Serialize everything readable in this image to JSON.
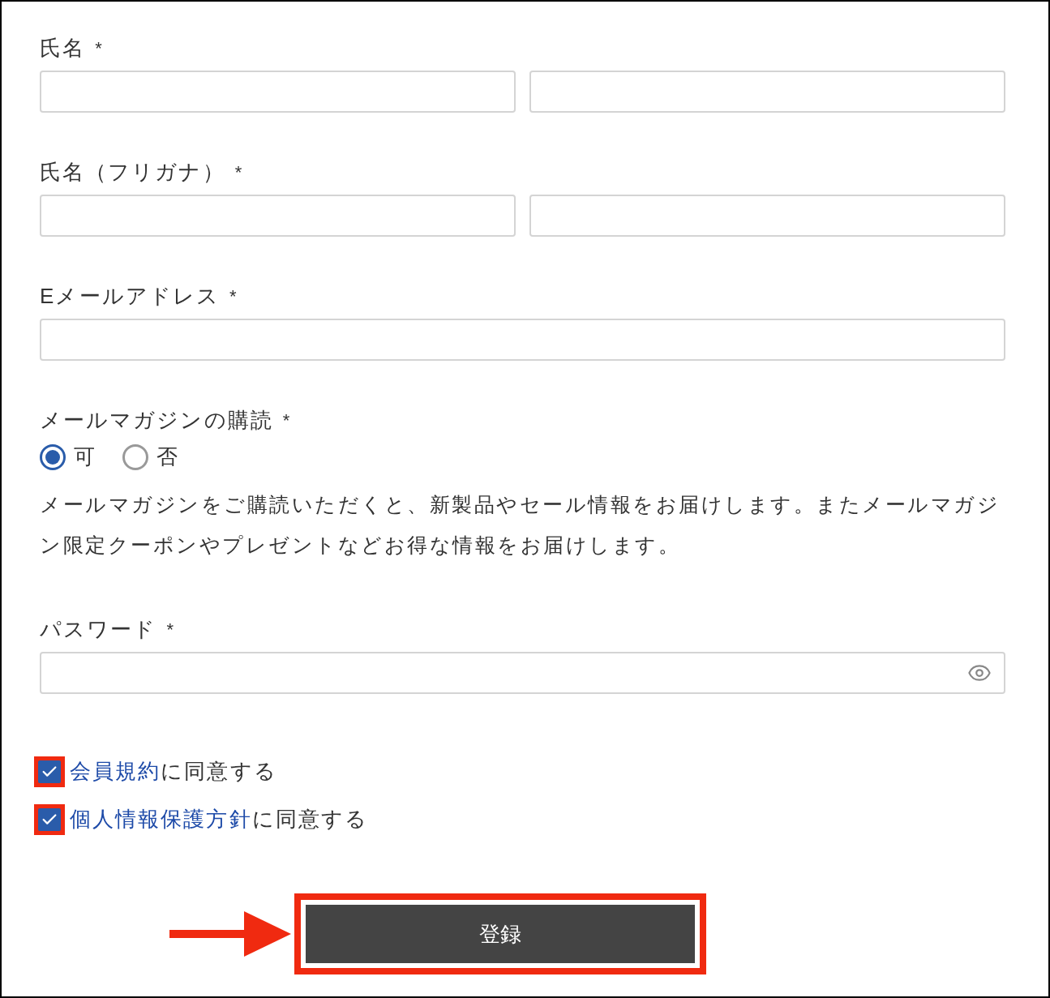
{
  "fields": [
    {
      "label": "氏名",
      "required_mark": "*",
      "kind": "double"
    },
    {
      "label": "氏名（フリガナ）",
      "required_mark": "*",
      "kind": "double"
    },
    {
      "label": "Eメールアドレス",
      "required_mark": "*",
      "kind": "single"
    }
  ],
  "newsletter": {
    "label": "メールマガジンの購読",
    "required_mark": "*",
    "options": [
      {
        "label": "可",
        "selected": true
      },
      {
        "label": "否",
        "selected": false
      }
    ],
    "description": "メールマガジンをご購読いただくと、新製品やセール情報をお届けします。またメールマガジン限定クーポンやプレゼントなどお得な情報をお届けします。"
  },
  "password": {
    "label": "パスワード",
    "required_mark": "*"
  },
  "agreements": [
    {
      "link": "会員規約",
      "text": "に同意する",
      "checked": true,
      "highlighted": true
    },
    {
      "link": "個人情報保護方針",
      "text": "に同意する",
      "checked": true,
      "highlighted": true
    }
  ],
  "submit": {
    "label": "登録",
    "highlighted": true
  }
}
